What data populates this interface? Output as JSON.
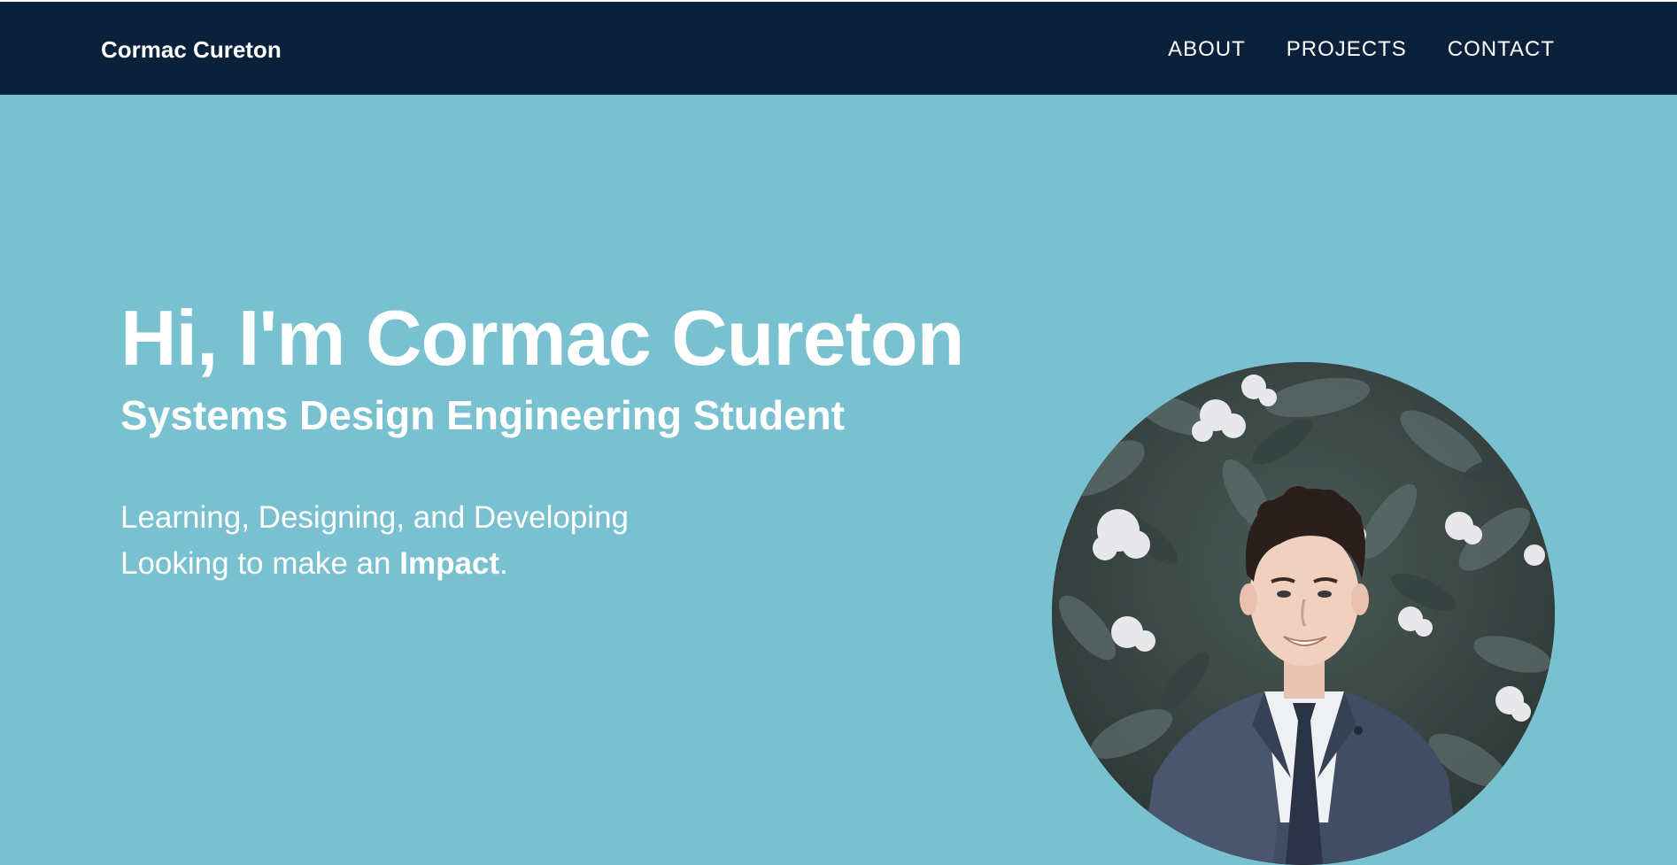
{
  "navbar": {
    "brand": "Cormac Cureton",
    "links": [
      {
        "label": "ABOUT"
      },
      {
        "label": "PROJECTS"
      },
      {
        "label": "CONTACT"
      }
    ]
  },
  "hero": {
    "title": "Hi, I'm Cormac Cureton",
    "subtitle": "Systems Design Engineering Student",
    "line1": "Learning, Designing, and Developing",
    "line2_prefix": "Looking to make an ",
    "line2_emphasis": "Impact",
    "line2_suffix": "."
  },
  "colors": {
    "navbar_bg": "#0b213b",
    "hero_bg": "#79c1d0",
    "text": "#ffffff"
  }
}
